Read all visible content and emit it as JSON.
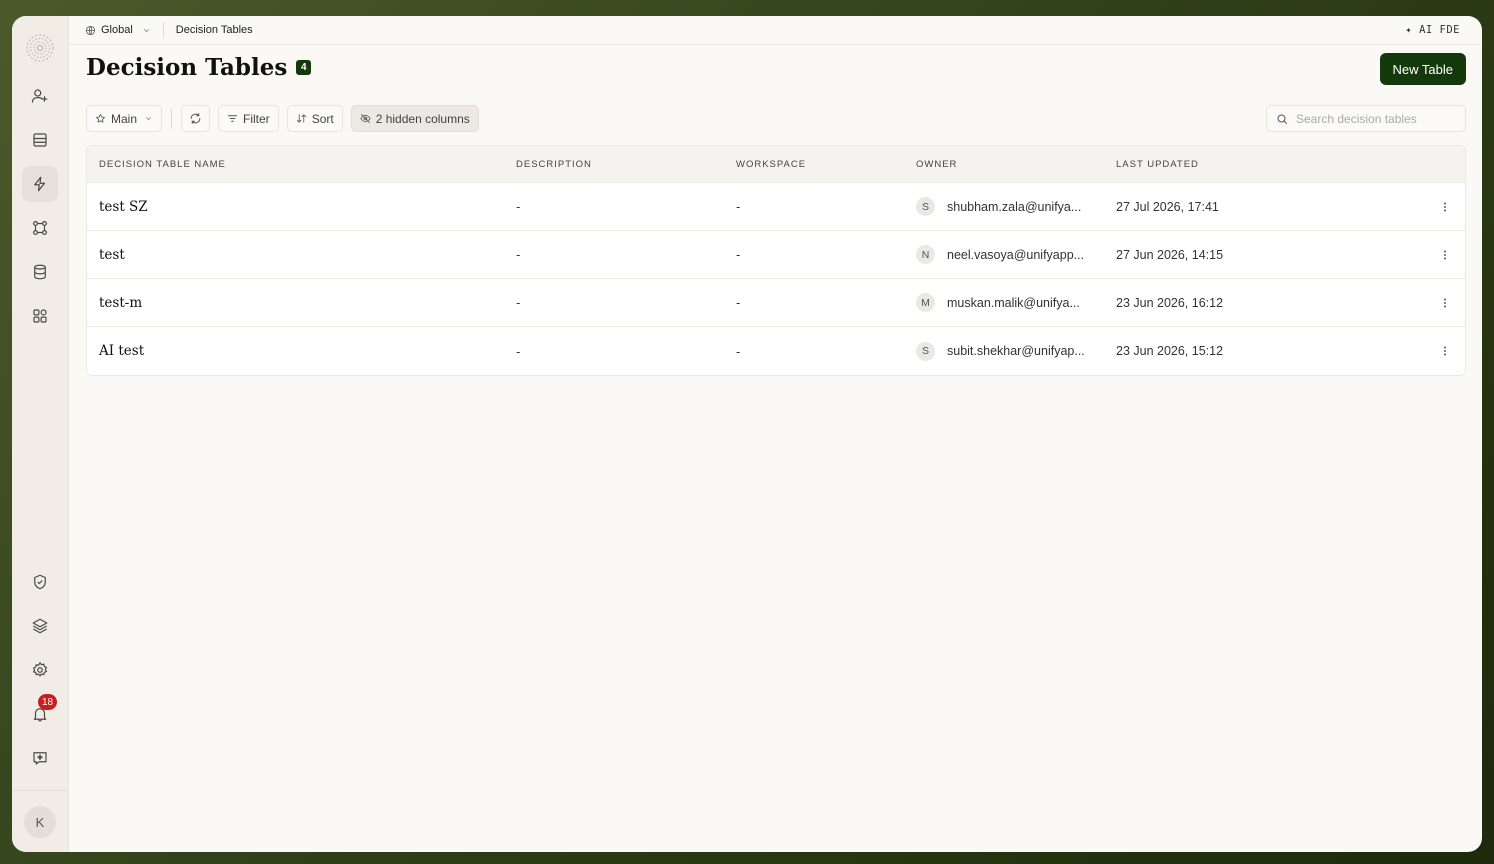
{
  "breadcrumb": {
    "workspace": "Global",
    "current": "Decision Tables"
  },
  "top_right": {
    "label": "✦ AI FDE"
  },
  "page": {
    "title": "Decision Tables",
    "count": "4",
    "new_button": "New Table"
  },
  "toolbar": {
    "view_label": "Main",
    "filter_label": "Filter",
    "sort_label": "Sort",
    "hidden_columns_label": "2 hidden columns"
  },
  "search": {
    "placeholder": "Search decision tables"
  },
  "table": {
    "headers": [
      "DECISION TABLE NAME",
      "DESCRIPTION",
      "WORKSPACE",
      "OWNER",
      "LAST UPDATED"
    ],
    "rows": [
      {
        "name": "test SZ",
        "description": "-",
        "workspace": "-",
        "owner_initial": "S",
        "owner": "shubham.zala@unifya...",
        "updated": "27 Jul 2026, 17:41"
      },
      {
        "name": "test",
        "description": "-",
        "workspace": "-",
        "owner_initial": "N",
        "owner": "neel.vasoya@unifyapp...",
        "updated": "27 Jun 2026, 14:15"
      },
      {
        "name": "test-m",
        "description": "-",
        "workspace": "-",
        "owner_initial": "M",
        "owner": "muskan.malik@unifya...",
        "updated": "23 Jun 2026, 16:12"
      },
      {
        "name": "AI test",
        "description": "-",
        "workspace": "-",
        "owner_initial": "S",
        "owner": "subit.shekhar@unifyap...",
        "updated": "23 Jun 2026, 15:12"
      }
    ]
  },
  "sidebar": {
    "icons": [
      "users-icon",
      "inbox-icon",
      "bolt-icon",
      "workflow-icon",
      "database-icon",
      "apps-icon",
      "shield-check-icon",
      "layers-icon",
      "gear-icon",
      "bell-icon",
      "chat-sparkle-icon"
    ],
    "notification_count": "18",
    "user_initial": "K"
  },
  "colors": {
    "primary": "#143a0c",
    "badge_red": "#c81e1e",
    "sidebar_bg": "#f1ece6"
  }
}
